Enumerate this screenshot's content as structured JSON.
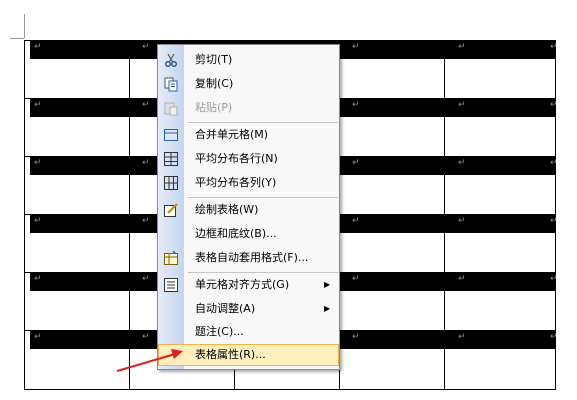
{
  "document": {
    "row_count": 6,
    "cell_mark": "↵"
  },
  "context_menu": {
    "items": [
      {
        "label": "剪切(T)",
        "icon": "scissors-icon"
      },
      {
        "label": "复制(C)",
        "icon": "copy-icon"
      },
      {
        "label": "粘贴(P)",
        "icon": "paste-icon",
        "disabled": true
      },
      {
        "label": "合并单元格(M)",
        "icon": "merge-cells-icon"
      },
      {
        "label": "平均分布各行(N)",
        "icon": "distribute-rows-icon"
      },
      {
        "label": "平均分布各列(Y)",
        "icon": "distribute-columns-icon"
      },
      {
        "label": "绘制表格(W)",
        "icon": "draw-table-icon"
      },
      {
        "label": "边框和底纹(B)...",
        "icon": ""
      },
      {
        "label": "表格自动套用格式(F)...",
        "icon": "table-autoformat-icon"
      },
      {
        "label": "单元格对齐方式(G)",
        "icon": "cell-alignment-icon",
        "submenu": true
      },
      {
        "label": "自动调整(A)",
        "icon": "",
        "submenu": true
      },
      {
        "label": "题注(C)...",
        "icon": ""
      },
      {
        "label": "表格属性(R)...",
        "icon": "",
        "highlighted": true
      }
    ]
  },
  "colors": {
    "highlight_fill": "#ffefbd",
    "highlight_border": "#f2b24e",
    "arrow": "#e02020"
  }
}
